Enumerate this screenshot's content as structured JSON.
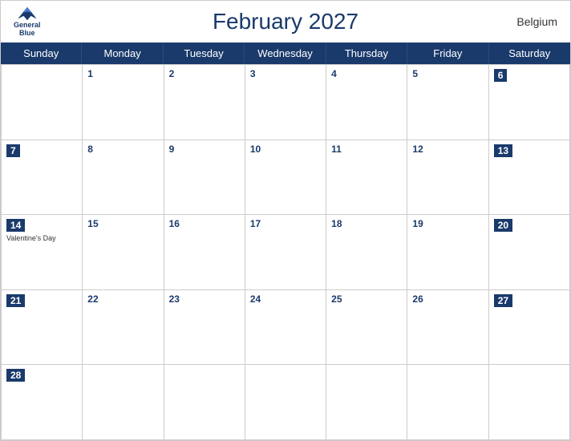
{
  "header": {
    "title": "February 2027",
    "country": "Belgium",
    "logo_line1": "General",
    "logo_line2": "Blue"
  },
  "day_headers": [
    "Sunday",
    "Monday",
    "Tuesday",
    "Wednesday",
    "Thursday",
    "Friday",
    "Saturday"
  ],
  "weeks": [
    [
      {
        "day": "",
        "weekend": true
      },
      {
        "day": "1",
        "weekend": false
      },
      {
        "day": "2",
        "weekend": false
      },
      {
        "day": "3",
        "weekend": false
      },
      {
        "day": "4",
        "weekend": false
      },
      {
        "day": "5",
        "weekend": false
      },
      {
        "day": "6",
        "weekend": true
      }
    ],
    [
      {
        "day": "7",
        "weekend": true
      },
      {
        "day": "8",
        "weekend": false
      },
      {
        "day": "9",
        "weekend": false
      },
      {
        "day": "10",
        "weekend": false
      },
      {
        "day": "11",
        "weekend": false
      },
      {
        "day": "12",
        "weekend": false
      },
      {
        "day": "13",
        "weekend": true
      }
    ],
    [
      {
        "day": "14",
        "weekend": true,
        "event": "Valentine's Day"
      },
      {
        "day": "15",
        "weekend": false
      },
      {
        "day": "16",
        "weekend": false
      },
      {
        "day": "17",
        "weekend": false
      },
      {
        "day": "18",
        "weekend": false
      },
      {
        "day": "19",
        "weekend": false
      },
      {
        "day": "20",
        "weekend": true
      }
    ],
    [
      {
        "day": "21",
        "weekend": true
      },
      {
        "day": "22",
        "weekend": false
      },
      {
        "day": "23",
        "weekend": false
      },
      {
        "day": "24",
        "weekend": false
      },
      {
        "day": "25",
        "weekend": false
      },
      {
        "day": "26",
        "weekend": false
      },
      {
        "day": "27",
        "weekend": true
      }
    ],
    [
      {
        "day": "28",
        "weekend": true
      },
      {
        "day": "",
        "weekend": false
      },
      {
        "day": "",
        "weekend": false
      },
      {
        "day": "",
        "weekend": false
      },
      {
        "day": "",
        "weekend": false
      },
      {
        "day": "",
        "weekend": false
      },
      {
        "day": "",
        "weekend": true
      }
    ]
  ]
}
